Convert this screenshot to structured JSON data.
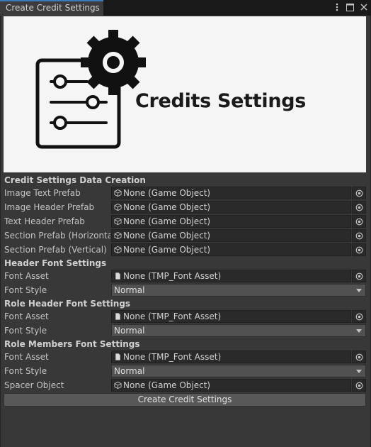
{
  "window": {
    "tab_title": "Create Credit Settings",
    "banner_title": "Credits Settings"
  },
  "sections": {
    "data_creation": "Credit Settings Data Creation",
    "header_font": "Header Font Settings",
    "role_header_font": "Role Header Font Settings",
    "role_members_font": "Role Members Font Settings"
  },
  "fields": {
    "image_text_prefab": {
      "label": "Image Text Prefab",
      "value": "None (Game Object)",
      "icon": "cube-icon"
    },
    "image_header_prefab": {
      "label": "Image Header Prefab",
      "value": "None (Game Object)",
      "icon": "cube-icon"
    },
    "text_header_prefab": {
      "label": "Text Header Prefab",
      "value": "None (Game Object)",
      "icon": "cube-icon"
    },
    "section_prefab_h": {
      "label": "Section Prefab (Horizontal)",
      "value": "None (Game Object)",
      "icon": "cube-icon"
    },
    "section_prefab_v": {
      "label": "Section Prefab (Vertical)",
      "value": "None (Game Object)",
      "icon": "cube-icon"
    },
    "header_font_asset": {
      "label": "Font Asset",
      "value": "None (TMP_Font Asset)",
      "icon": "file-icon"
    },
    "header_font_style": {
      "label": "Font Style",
      "value": "Normal"
    },
    "role_header_font_asset": {
      "label": "Font Asset",
      "value": "None (TMP_Font Asset)",
      "icon": "file-icon"
    },
    "role_header_font_style": {
      "label": "Font Style",
      "value": "Normal"
    },
    "role_members_font_asset": {
      "label": "Font Asset",
      "value": "None (TMP_Font Asset)",
      "icon": "file-icon"
    },
    "role_members_font_style": {
      "label": "Font Style",
      "value": "Normal"
    },
    "spacer_object": {
      "label": "Spacer Object",
      "value": "None (Game Object)",
      "icon": "cube-icon"
    }
  },
  "actions": {
    "create_button": "Create Credit Settings"
  },
  "colors": {
    "background": "#383838",
    "field": "#2a2a2a",
    "dropdown": "#515151",
    "tab_accent": "#3a79bb"
  }
}
